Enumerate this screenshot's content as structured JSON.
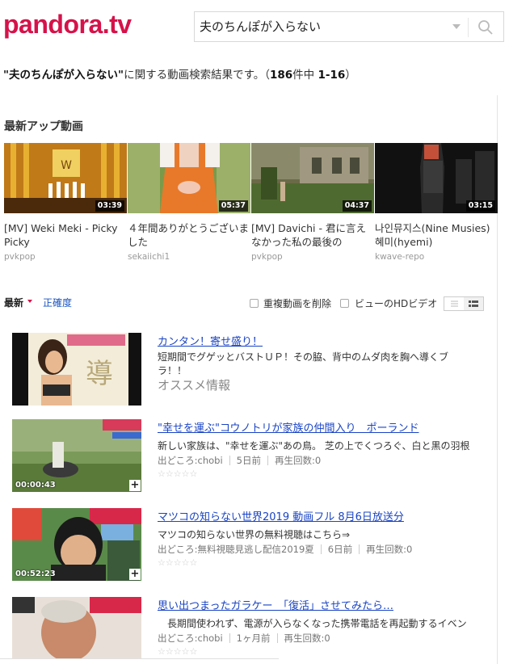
{
  "logo": "pandora.tv",
  "search": {
    "value": "夫のちんぽが入らない"
  },
  "result": {
    "query": "\"夫のちんぽが入らない\"",
    "text": "に関する動画検索結果です。（",
    "count": "186",
    "count_unit": "件中",
    "range": "1-16",
    "close": "）"
  },
  "latest": {
    "title": "最新アップ動画",
    "videos": [
      {
        "duration": "03:39",
        "title": "[MV] Weki Meki - Picky Picky",
        "source": "pvkpop"
      },
      {
        "duration": "05:37",
        "title": "４年間ありがとうございました",
        "source": "sekaiichi1"
      },
      {
        "duration": "04:37",
        "title": "[MV] Davichi - 君に言えなかった私の最後の",
        "source": "pvkpop"
      },
      {
        "duration": "03:15",
        "title": "나인뮤지스(Nine Musies) 혜미(hyemi)",
        "source": "kwave-repo"
      }
    ]
  },
  "sort": {
    "latest": "最新",
    "accuracy": "正確度",
    "dedupe": "重複動画を削除",
    "hd": "ビューのHDビデオ"
  },
  "ad": {
    "title": "カンタン！寄せ盛り！",
    "desc": "短期間でグゲッとバストＵＰ！その脇、背中のムダ肉を胸へ導くブラ！！",
    "tag": "オススメ情報"
  },
  "items": [
    {
      "title": "\"幸せを運ぶ\"コウノトリが家族の仲間入り　ポーランド",
      "desc": "新しい家族は、\"幸せを運ぶ\"あの鳥。 芝の上でくつろぐ、白と黒の羽根",
      "source": "出どころ:chobi",
      "when": "5日前",
      "views": "再生回数:0",
      "duration": "00:00:43",
      "stars": "☆☆☆☆☆"
    },
    {
      "title": "マツコの知らない世界2019 動画フル 8月6日放送分",
      "desc": "マツコの知らない世界の無料視聴はこちら⇒",
      "source": "出どころ:無料視聴見逃し配信2019夏",
      "when": "6日前",
      "views": "再生回数:0",
      "duration": "00:52:23",
      "stars": "☆☆☆☆☆"
    },
    {
      "title": "思い出つまったガラケー　「復活」させてみたら…",
      "desc": "　長期間使われず、電源が入らなくなった携帯電話を再起動するイベン",
      "source": "出どころ:chobi",
      "when": "1ヶ月前",
      "views": "再生回数:0",
      "stars": "☆☆☆☆☆"
    }
  ],
  "colors": {
    "brand": "#d6124a",
    "link": "#1a44c4"
  }
}
